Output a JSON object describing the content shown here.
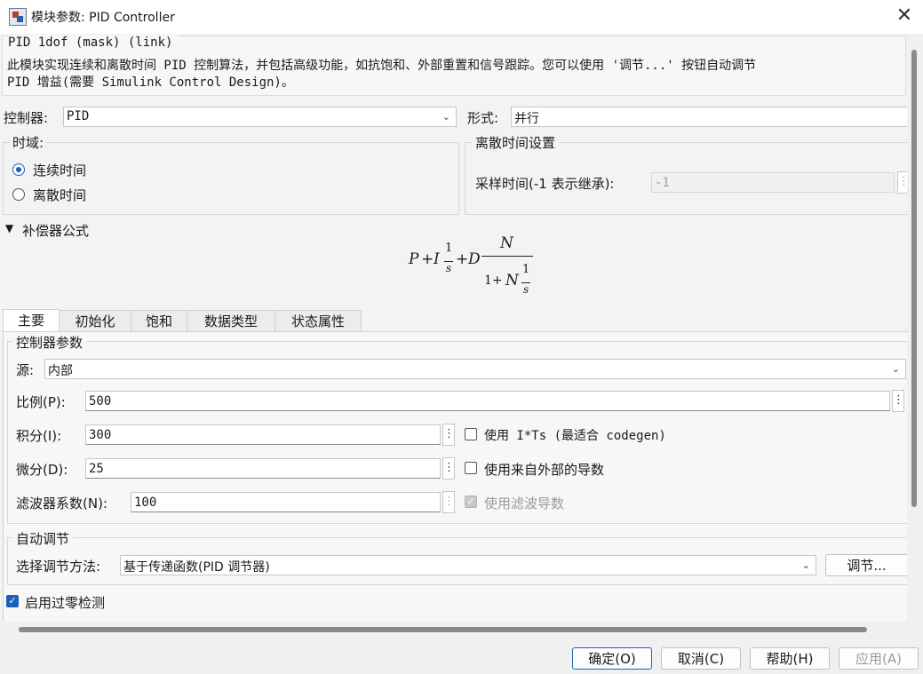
{
  "window": {
    "title": "模块参数: PID Controller"
  },
  "description": {
    "title": "PID 1dof (mask) (link)",
    "text": "此模块实现连续和离散时间 PID 控制算法，并包括高级功能，如抗饱和、外部重置和信号跟踪。您可以使用 '调节...' 按钮自动调节\nPID 增益(需要 Simulink Control Design)。"
  },
  "controller": {
    "label": "控制器:",
    "value": "PID"
  },
  "form": {
    "label": "形式:",
    "value": "并行"
  },
  "time_domain": {
    "title": "时域:",
    "options": [
      "连续时间",
      "离散时间"
    ],
    "selected": "连续时间"
  },
  "discrete_settings": {
    "title": "离散时间设置",
    "sample_time_label": "采样时间(-1 表示继承):",
    "sample_time_value": "-1"
  },
  "compensator": {
    "label": "补偿器公式"
  },
  "formula": {
    "P": "P",
    "plus1": "+",
    "I": "I",
    "one1": "1",
    "s1": "s",
    "plus2": "+",
    "D": "D",
    "N_num": "N",
    "one_plus": "1+",
    "N_den": "N",
    "one2": "1",
    "s2": "s"
  },
  "tabs": [
    "主要",
    "初始化",
    "饱和",
    "数据类型",
    "状态属性"
  ],
  "active_tab": "主要",
  "controller_params": {
    "title": "控制器参数",
    "source_label": "源:",
    "source_value": "内部",
    "p_label": "比例(P):",
    "p_value": "500",
    "i_label": "积分(I):",
    "i_value": "300",
    "d_label": "微分(D):",
    "d_value": "25",
    "n_label": "滤波器系数(N):",
    "n_value": "100",
    "use_its_label": "使用 I*Ts (最适合 codegen)",
    "use_ext_deriv_label": "使用来自外部的导数",
    "use_filter_label": "使用滤波导数"
  },
  "auto_tune": {
    "title": "自动调节",
    "method_label": "选择调节方法:",
    "method_value": "基于传递函数(PID 调节器)",
    "tune_button": "调节..."
  },
  "zero_crossing": {
    "label": "启用过零检测",
    "checked": true
  },
  "buttons": {
    "ok": "确定(O)",
    "cancel": "取消(C)",
    "help": "帮助(H)",
    "apply": "应用(A)"
  },
  "icons": {
    "app": "simulink-block-icon",
    "close": "close-icon",
    "collapse": "triangle-down-icon",
    "menu": "vertical-ellipsis-icon",
    "dropdown": "chevron-down-icon"
  },
  "colors": {
    "accent": "#1b5fbf"
  }
}
